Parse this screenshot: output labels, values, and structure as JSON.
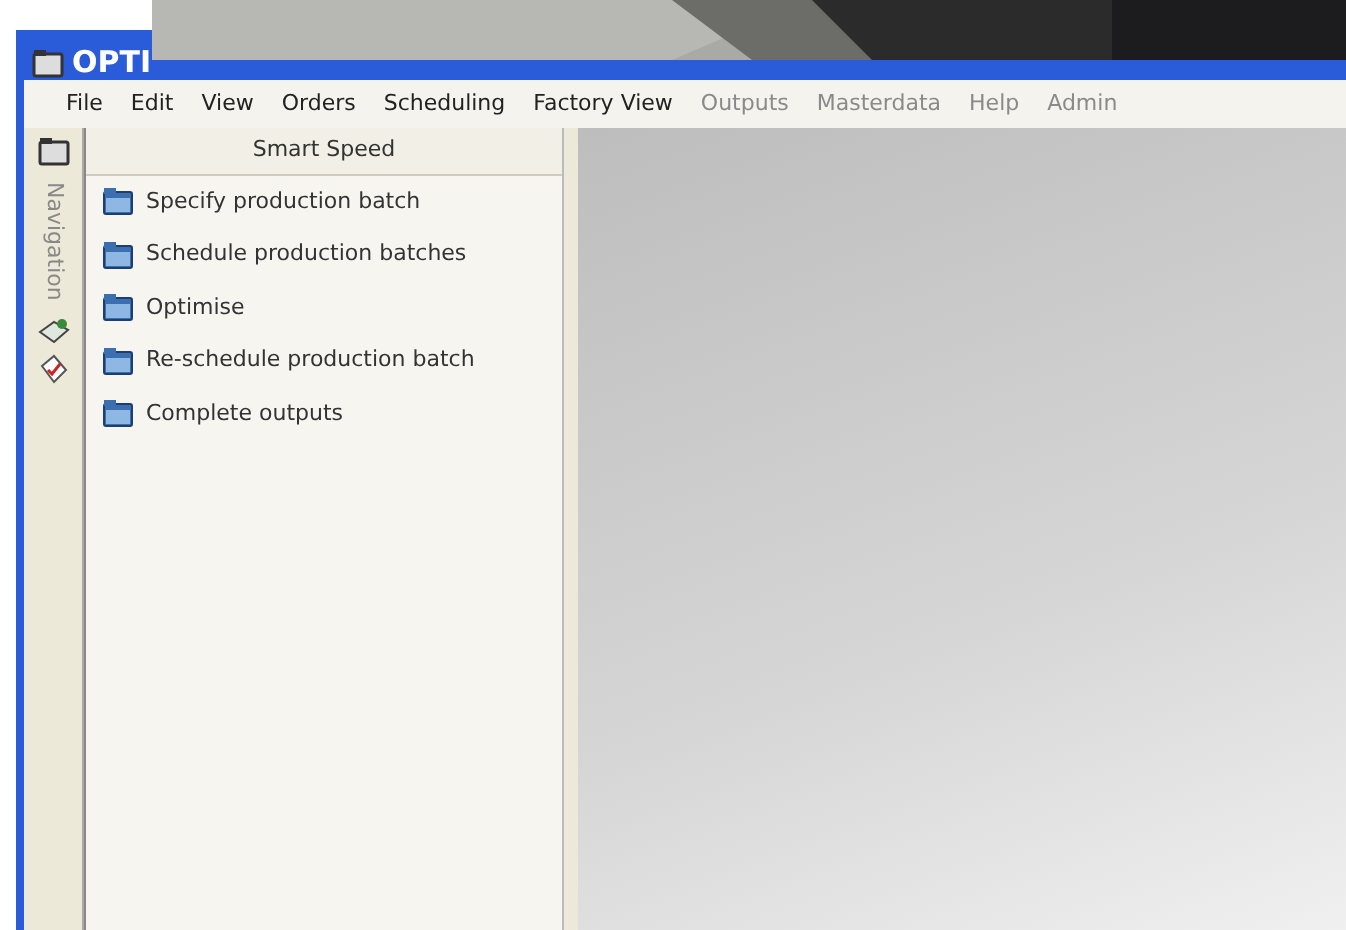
{
  "window": {
    "title": "OPTI"
  },
  "menu": [
    {
      "label": "File",
      "disabled": false
    },
    {
      "label": "Edit",
      "disabled": false
    },
    {
      "label": "View",
      "disabled": false
    },
    {
      "label": "Orders",
      "disabled": false
    },
    {
      "label": "Scheduling",
      "disabled": false
    },
    {
      "label": "Factory View",
      "disabled": false
    },
    {
      "label": "Outputs",
      "disabled": true
    },
    {
      "label": "Masterdata",
      "disabled": true
    },
    {
      "label": "Help",
      "disabled": true
    },
    {
      "label": "Admin",
      "disabled": true
    }
  ],
  "side_tabs": [
    {
      "kind": "folder"
    },
    {
      "kind": "text",
      "label": "Navigation"
    },
    {
      "kind": "gear"
    },
    {
      "kind": "check"
    }
  ],
  "panel": {
    "title": "Smart Speed",
    "items": [
      {
        "label": "Specify production batch"
      },
      {
        "label": "Schedule production batches"
      },
      {
        "label": "Optimise"
      },
      {
        "label": "Re-schedule production batch"
      },
      {
        "label": "Complete outputs"
      }
    ]
  }
}
